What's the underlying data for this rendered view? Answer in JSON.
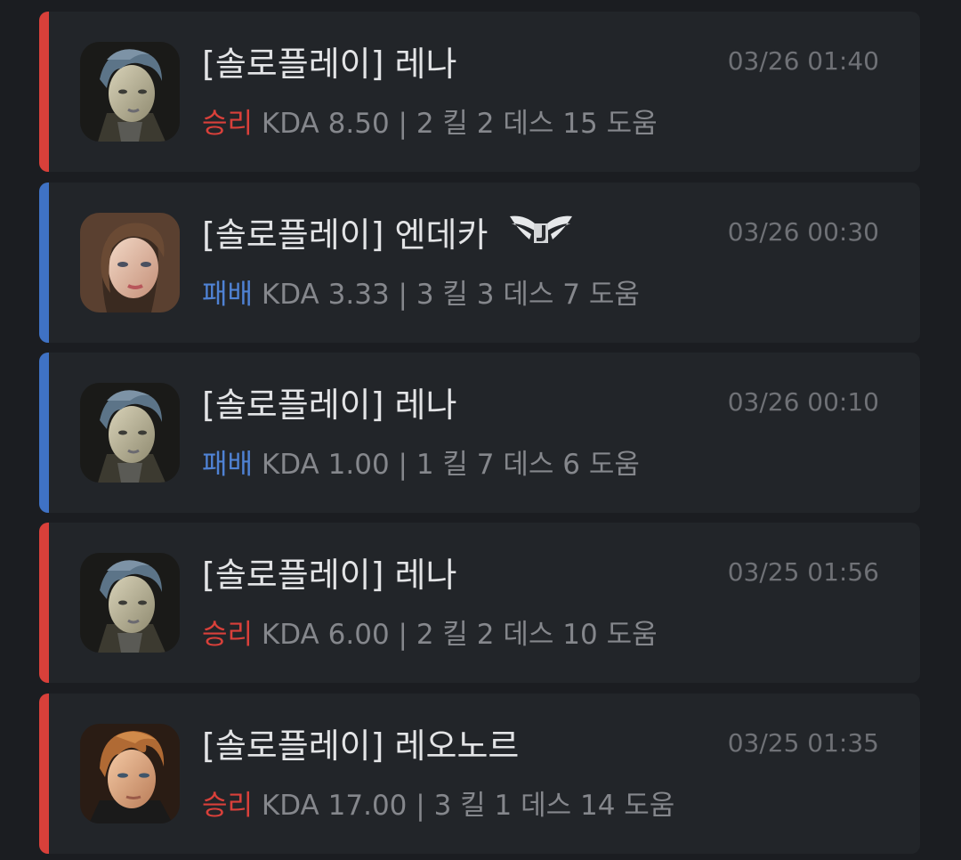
{
  "matches": [
    {
      "mode": "[솔로플레이]",
      "character": "레나",
      "result": "승리",
      "kda_label": "KDA",
      "kda": "8.50",
      "stats": "2 킬 2 데스 15 도움",
      "time": "03/26 01:40",
      "avatar": "lena-portrait"
    },
    {
      "mode": "[솔로플레이]",
      "character": "엔데카",
      "result": "패배",
      "kda_label": "KDA",
      "kda": "3.33",
      "stats": "3 킬 3 데스 7 도움",
      "time": "03/26 00:30",
      "avatar": "endeka-portrait",
      "badge": "winged-j-emblem-icon"
    },
    {
      "mode": "[솔로플레이]",
      "character": "레나",
      "result": "패배",
      "kda_label": "KDA",
      "kda": "1.00",
      "stats": "1 킬 7 데스 6 도움",
      "time": "03/26 00:10",
      "avatar": "lena-portrait"
    },
    {
      "mode": "[솔로플레이]",
      "character": "레나",
      "result": "승리",
      "kda_label": "KDA",
      "kda": "6.00",
      "stats": "2 킬 2 데스 10 도움",
      "time": "03/25 01:56",
      "avatar": "lena-portrait"
    },
    {
      "mode": "[솔로플레이]",
      "character": "레오노르",
      "result": "승리",
      "kda_label": "KDA",
      "kda": "17.00",
      "stats": "3 킬 1 데스 14 도움",
      "time": "03/25 01:35",
      "avatar": "leonor-portrait"
    }
  ],
  "colors": {
    "win": "#d9403a",
    "lose": "#3f72c5",
    "background": "#1b1d21",
    "card": "#222529"
  }
}
